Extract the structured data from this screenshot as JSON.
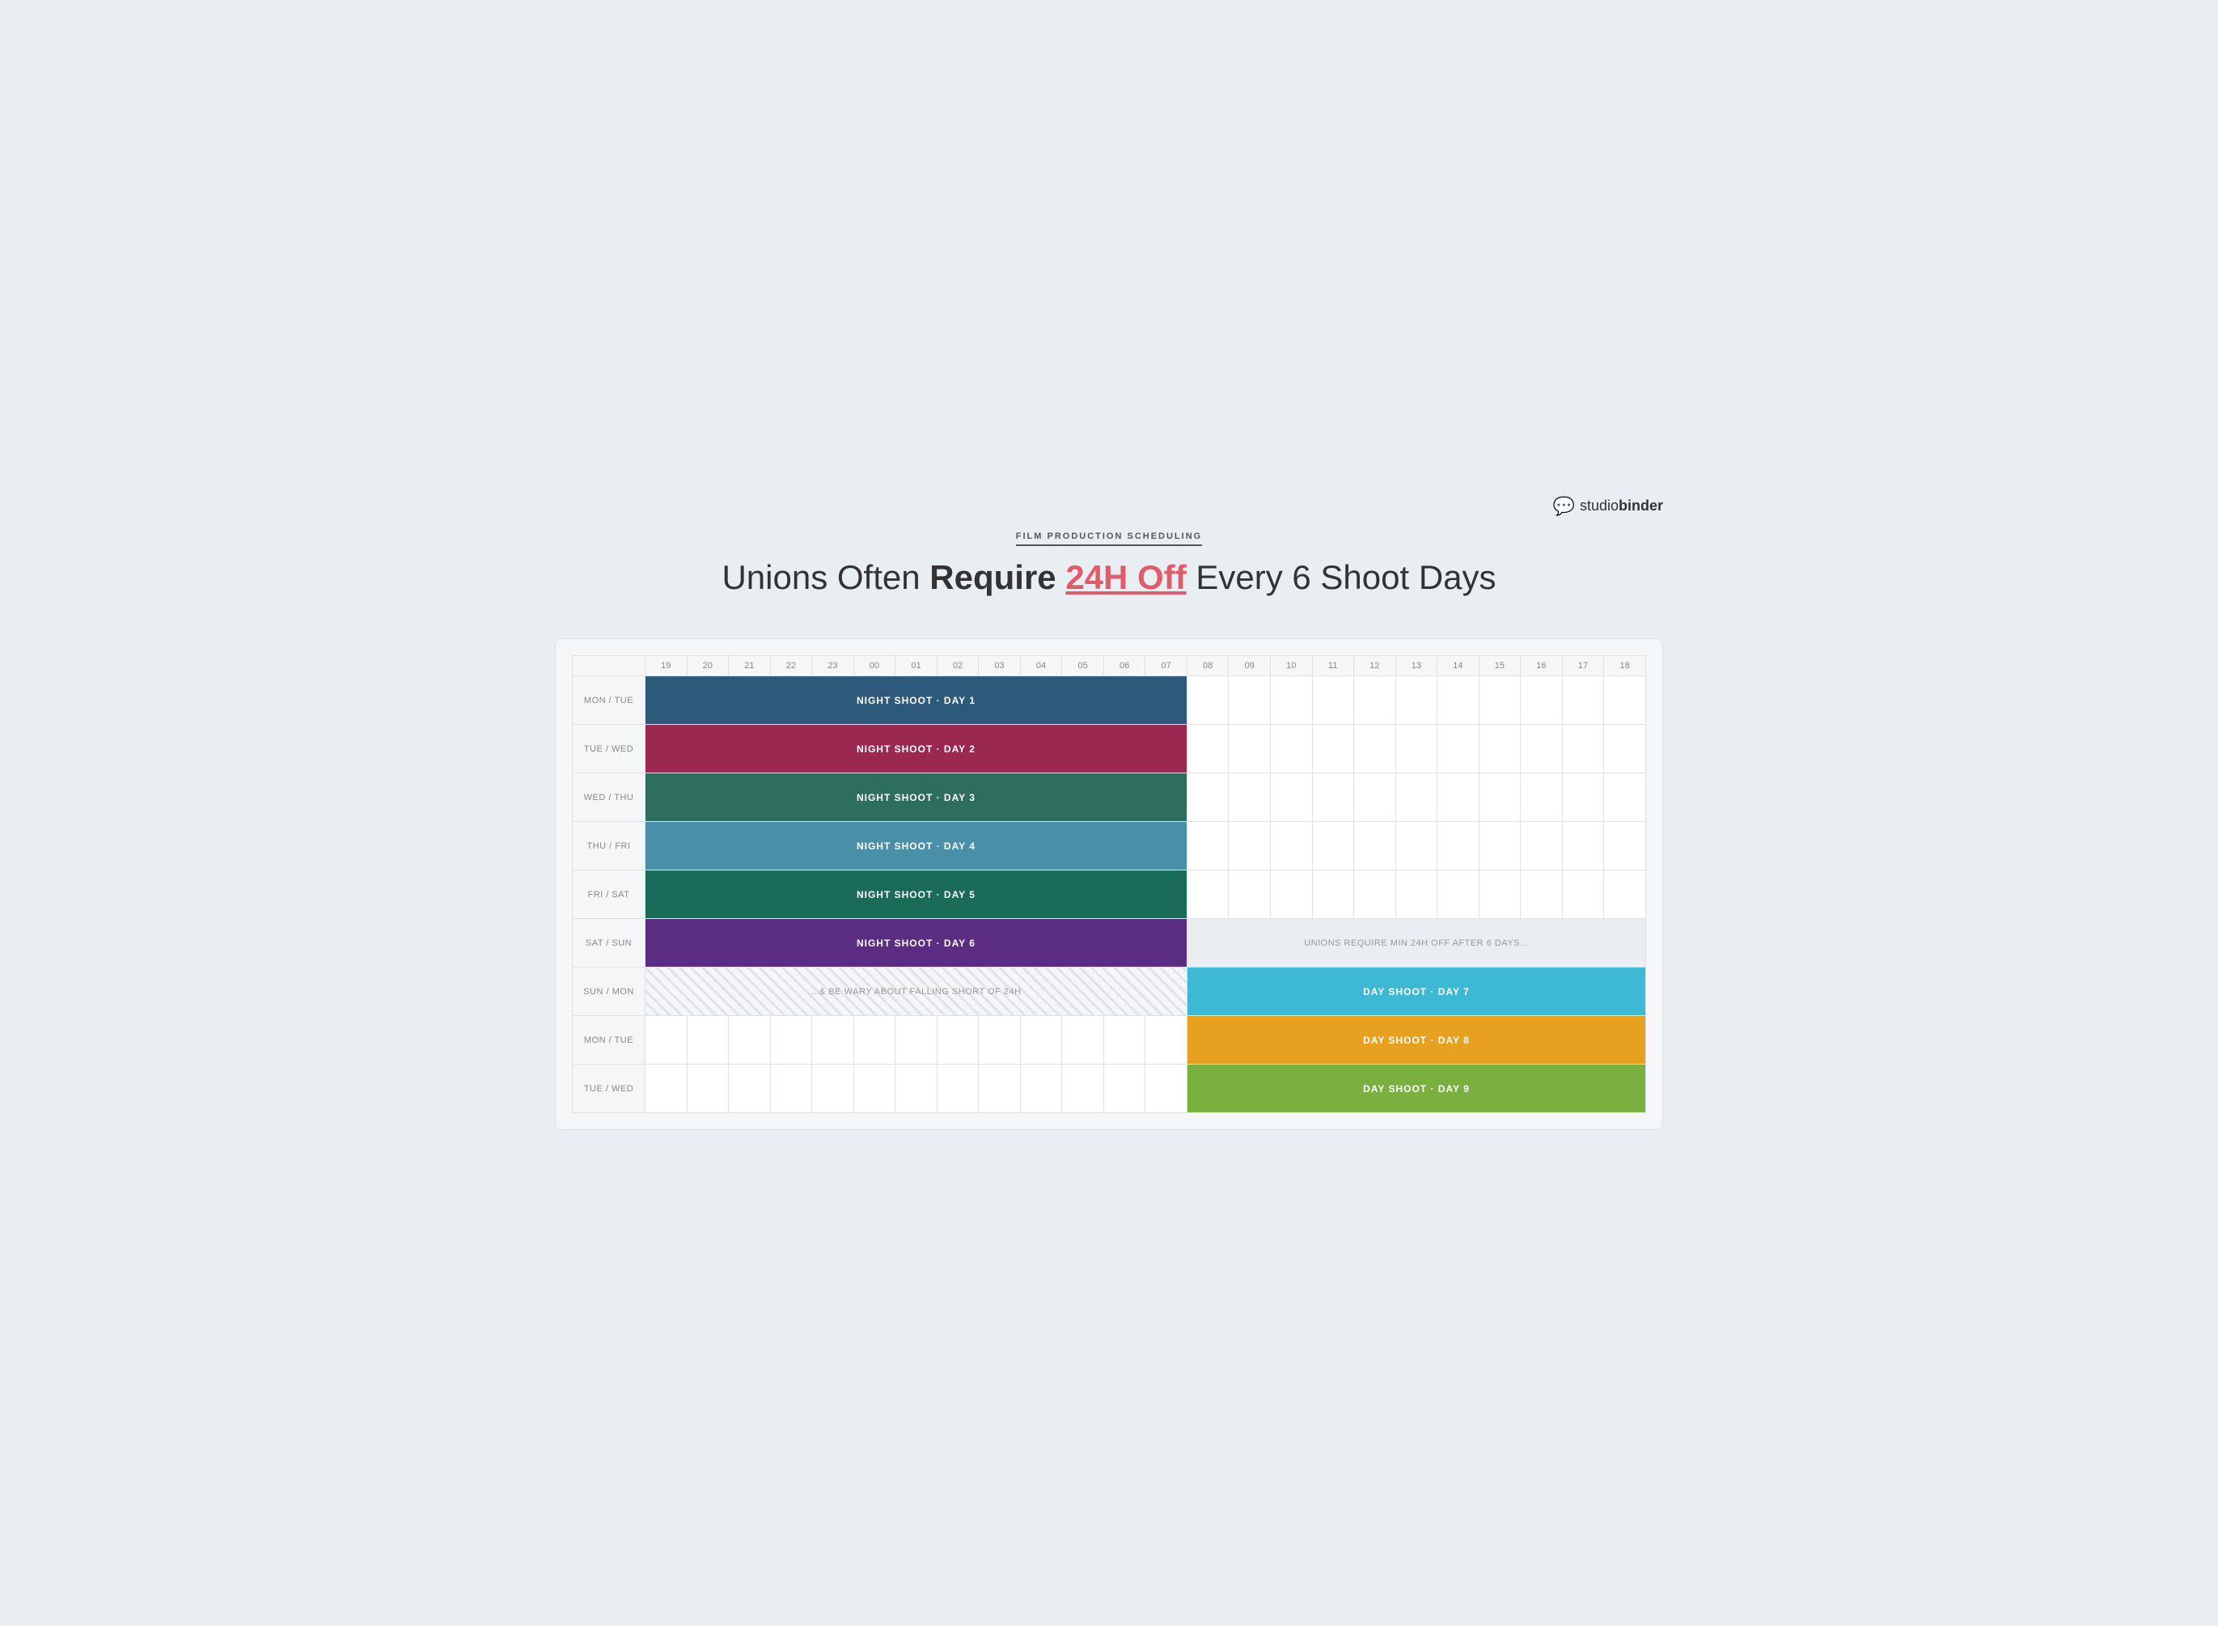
{
  "logo": {
    "text": "studiobinder",
    "bold": "binder"
  },
  "header": {
    "subtitle": "FILM PRODUCTION SCHEDULING",
    "title_pre": "Unions Often ",
    "title_strong": "Require ",
    "title_highlight": "24H Off",
    "title_post": " Every 6 Shoot Days"
  },
  "hours": [
    "19",
    "20",
    "21",
    "22",
    "23",
    "00",
    "01",
    "02",
    "03",
    "04",
    "05",
    "06",
    "07",
    "08",
    "09",
    "10",
    "11",
    "12",
    "13",
    "14",
    "15",
    "16",
    "17",
    "18"
  ],
  "rows": [
    {
      "label": "MON / TUE",
      "bar_start": 0,
      "bar_end": 13,
      "bar_label": "NIGHT SHOOT · DAY 1",
      "bar_class": "bar-night1"
    },
    {
      "label": "TUE / WED",
      "bar_start": 0,
      "bar_end": 13,
      "bar_label": "NIGHT SHOOT · DAY 2",
      "bar_class": "bar-night2"
    },
    {
      "label": "WED / THU",
      "bar_start": 0,
      "bar_end": 13,
      "bar_label": "NIGHT SHOOT · DAY 3",
      "bar_class": "bar-night3"
    },
    {
      "label": "THU / FRI",
      "bar_start": 0,
      "bar_end": 13,
      "bar_label": "NIGHT SHOOT · DAY 4",
      "bar_class": "bar-night4"
    },
    {
      "label": "FRI / SAT",
      "bar_start": 0,
      "bar_end": 13,
      "bar_label": "NIGHT SHOOT · DAY 5",
      "bar_class": "bar-night5"
    },
    {
      "label": "SAT / SUN",
      "bar_start": 0,
      "bar_end": 13,
      "bar_label": "NIGHT SHOOT · DAY 6",
      "bar_class": "bar-night6",
      "right_message": "UNIONS REQUIRE MIN 24H OFF AFTER 6 DAYS..."
    },
    {
      "label": "SUN / MON",
      "left_message": "...& BE WARY ABOUT FALLING SHORT OF 24H",
      "left_cols": 13,
      "bar_start": 13,
      "bar_end": 24,
      "bar_label": "DAY SHOOT · DAY 7",
      "bar_class": "bar-day7"
    },
    {
      "label": "MON / TUE",
      "bar_start": 13,
      "bar_end": 24,
      "bar_label": "DAY SHOOT · DAY 8",
      "bar_class": "bar-day8",
      "empty_left": true
    },
    {
      "label": "TUE / WED",
      "bar_start": 13,
      "bar_end": 24,
      "bar_label": "DAY SHOOT · DAY 9",
      "bar_class": "bar-day9",
      "empty_left": true
    }
  ]
}
